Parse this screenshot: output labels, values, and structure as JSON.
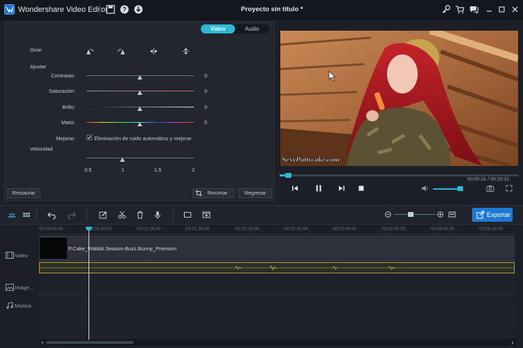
{
  "app": {
    "name": "Wondershare Video Editor",
    "project_title": "Proyecto sin título *"
  },
  "edit_panel": {
    "tabs": {
      "video": "Video",
      "audio": "Audio",
      "active": "Video"
    },
    "rotate_label": "Girar",
    "adjust_label": "Ajustar",
    "sliders": [
      {
        "label": "Contraste:",
        "value": "0",
        "fraction": 0.5
      },
      {
        "label": "Saturación:",
        "value": "0",
        "fraction": 0.5
      },
      {
        "label": "Brillo:",
        "value": "0",
        "fraction": 0.5
      },
      {
        "label": "Matiz:",
        "value": "0",
        "fraction": 0.5
      }
    ],
    "improve_label": "Mejorar:",
    "improve_option": "Eliminación de ruido automático y mejorar",
    "improve_checked": true,
    "speed_label": "Velocidad",
    "speed_ticks": [
      "0.5",
      "1",
      "1.5",
      "2"
    ],
    "speed_value": 1,
    "restore_button": "Restaurar",
    "crop_button": "Recortar",
    "reset_button": "Regresar"
  },
  "preview": {
    "watermark": "SexyPattycake.com",
    "time": "00:00:31 / 00:20:31",
    "progress_fraction": 0.025,
    "volume_fraction": 0.85
  },
  "toolbar": {
    "export_button": "Exportar"
  },
  "timeline": {
    "ruler_ticks": [
      "00:00:00:00",
      "00:00:30:00",
      "00:01:00:00",
      "00:01:30:00",
      "00:02:00:00",
      "00:02:30:00",
      "00:03:00:00",
      "00:03:30:00",
      "00:04:00:00",
      "00:04:30:00"
    ],
    "tracks": {
      "video": "Video",
      "image": "Imáge...",
      "music": "Música"
    },
    "clip_name": "P.Cake_Wabbit.Season-Buzz.Bunny_Premium",
    "playhead_time": "00:00:30:00"
  },
  "colors": {
    "accent": "#2ab8d2",
    "export": "#1e79d6",
    "audio_border": "#b6a436"
  }
}
